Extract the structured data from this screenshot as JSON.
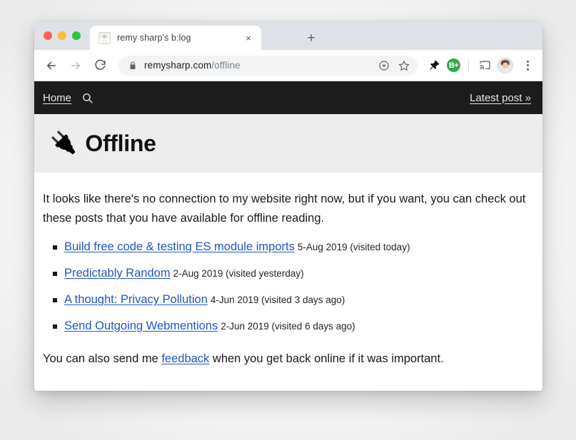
{
  "window_controls": {
    "close_label": "close",
    "minimize_label": "minimize",
    "maximize_label": "maximize"
  },
  "tab": {
    "title": "remy sharp's b:log",
    "close_glyph": "×",
    "newtab_glyph": "+",
    "favicon_name": "site-favicon-photo"
  },
  "toolbar": {
    "back_label": "Back",
    "forward_label": "Forward",
    "reload_label": "Reload",
    "url_domain": "remysharp.com",
    "url_path": "/offline",
    "lock_label": "Secure",
    "share_label": "Share this page",
    "bookmark_label": "Bookmark this page",
    "pin_extension_label": "Pin extension",
    "badge_extension_label": "B+",
    "cast_label": "Cast",
    "profile_label": "Profile",
    "menu_label": "Customize and control Google Chrome"
  },
  "site_nav": {
    "home_label": "Home",
    "search_label": "Search",
    "latest_post_label": "Latest post »"
  },
  "hero": {
    "plug_glyph": "🔌",
    "title": "Offline"
  },
  "content": {
    "intro": "It looks like there's no connection to my website right now, but if you want, you can check out these posts that you have available for offline reading.",
    "posts": [
      {
        "title": "Build free code & testing ES module imports",
        "meta": "5-Aug 2019 (visited today)"
      },
      {
        "title": "Predictably Random",
        "meta": "2-Aug 2019 (visited yesterday)"
      },
      {
        "title": "A thought: Privacy Pollution",
        "meta": "4-Jun 2019 (visited 3 days ago)"
      },
      {
        "title": "Send Outgoing Webmentions",
        "meta": "2-Jun 2019 (visited 6 days ago)"
      }
    ],
    "outro_before": "You can also send me ",
    "outro_link": "feedback",
    "outro_after": " when you get back online if it was important."
  },
  "colors": {
    "nav_background": "#1c1c1c",
    "hero_background": "#ededed",
    "link_blue": "#2056c4",
    "tabstrip": "#dee1e6",
    "extension_green": "#34a853",
    "traffic_red": "#ff5f56",
    "traffic_yellow": "#febc2e",
    "traffic_green": "#28c840"
  }
}
